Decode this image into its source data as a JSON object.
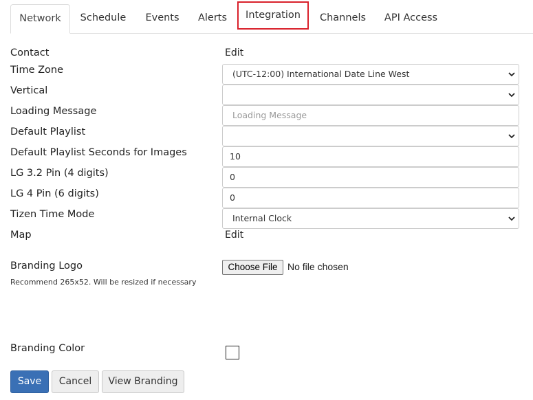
{
  "tabs": [
    {
      "label": "Network",
      "active": true
    },
    {
      "label": "Schedule"
    },
    {
      "label": "Events"
    },
    {
      "label": "Alerts"
    },
    {
      "label": "Integration",
      "highlighted": true
    },
    {
      "label": "Channels"
    },
    {
      "label": "API Access"
    }
  ],
  "form": {
    "contact": {
      "label": "Contact",
      "action": "Edit"
    },
    "time_zone": {
      "label": "Time Zone",
      "value": "(UTC-12:00) International Date Line West"
    },
    "vertical": {
      "label": "Vertical",
      "value": ""
    },
    "loading_message": {
      "label": "Loading Message",
      "placeholder": "Loading Message",
      "value": ""
    },
    "default_playlist": {
      "label": "Default Playlist",
      "value": ""
    },
    "default_playlist_seconds": {
      "label": "Default Playlist Seconds for Images",
      "value": "10"
    },
    "lg32_pin": {
      "label": "LG 3.2 Pin (4 digits)",
      "value": "0"
    },
    "lg4_pin": {
      "label": "LG 4 Pin (6 digits)",
      "value": "0"
    },
    "tizen_time_mode": {
      "label": "Tizen Time Mode",
      "value": "Internal Clock"
    },
    "map": {
      "label": "Map",
      "action": "Edit"
    },
    "branding_logo": {
      "label": "Branding Logo",
      "button": "Choose File",
      "status": "No file chosen",
      "hint": "Recommend 265x52. Will be resized if necessary"
    },
    "branding_color": {
      "label": "Branding Color",
      "value": "#ffffff"
    }
  },
  "actions": {
    "save": "Save",
    "cancel": "Cancel",
    "view_branding": "View Branding"
  },
  "colors": {
    "highlight": "#d9202a",
    "primary": "#3a70b5"
  }
}
